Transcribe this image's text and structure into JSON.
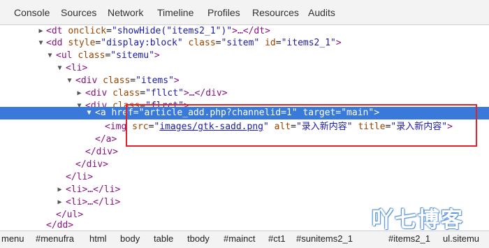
{
  "tabs": [
    "Console",
    "Sources",
    "Network",
    "Timeline",
    "Profiles",
    "Resources",
    "Audits"
  ],
  "tree": {
    "l0": {
      "open": "<dt",
      "attr1": "onclick",
      "eq": "=",
      "val1": "\"showHide(\"items2_1\")\"",
      "tail": ">…</dt>"
    },
    "l1": {
      "open": "<dd",
      "attr1": "style",
      "val1": "\"display:block\"",
      "attr2": "class",
      "val2": "\"sitem\"",
      "attr3": "id",
      "val3": "\"items2_1\"",
      "close": ">"
    },
    "l2": {
      "open": "<ul",
      "attr1": "class",
      "val1": "\"sitemu\"",
      "close": ">"
    },
    "l3": {
      "tag": "<li>"
    },
    "l4": {
      "open": "<div",
      "attr1": "class",
      "val1": "\"items\"",
      "close": ">"
    },
    "l5": {
      "open": "<div",
      "attr1": "class",
      "val1": "\"fllct\"",
      "tail": ">…</div>"
    },
    "l6": {
      "open": "<div",
      "attr1": "class",
      "val1": "\"flrct\"",
      "close": ">"
    },
    "l7": {
      "open": "<a",
      "attr1": "href",
      "val1": "\"article_add.php?channelid=1\"",
      "attr2": "target",
      "val2": "\"main\"",
      "close": ">"
    },
    "l8": {
      "open": "<img",
      "attr1": "src",
      "q1": "\"",
      "link": "images/gtk-sadd.png",
      "q2": "\"",
      "attr2": "alt",
      "val2": "\"录入新内容\"",
      "attr3": "title",
      "val3": "\"录入新内容\"",
      "close": ">"
    },
    "l9": {
      "tag": "</a>"
    },
    "l10": {
      "tag": "</div>"
    },
    "l11": {
      "tag": "</div>"
    },
    "l12": {
      "tag": "</li>"
    },
    "l13": {
      "tag": "<li>…</li>"
    },
    "l14": {
      "tag": "<li>…</li>"
    },
    "l15": {
      "tag": "</ul>"
    },
    "l16": {
      "tag": "</dd>"
    }
  },
  "watermark": "吖七博客",
  "breadcrumbs": [
    "menu",
    "#menufra",
    "html",
    "body",
    "table",
    "tbody",
    "#mainct",
    "#ct1",
    "#sunitems2_1",
    "#items2_1",
    "ul.sitemu"
  ],
  "colors": {
    "selection": "#3879d9",
    "highlight_box": "#e5222a",
    "tag": "#881280",
    "attr_name": "#994500",
    "attr_value": "#1a1aa6"
  }
}
